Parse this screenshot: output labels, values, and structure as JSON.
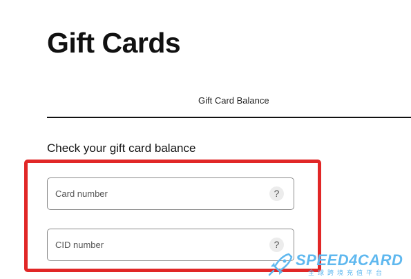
{
  "page": {
    "title": "Gift Cards"
  },
  "tabs": [
    {
      "label": "Gift Card Balance",
      "active": true
    }
  ],
  "balance_form": {
    "heading": "Check your gift card balance",
    "card_number": {
      "placeholder": "Card number",
      "value": "",
      "help_icon": "question-mark-icon",
      "help_glyph": "?"
    },
    "cid_number": {
      "placeholder": "CID number",
      "value": "",
      "help_icon": "question-mark-icon",
      "help_glyph": "?"
    }
  },
  "annotation": {
    "color": "#e12727"
  },
  "watermark": {
    "brand": "SPEED4CARD",
    "subtitle": "全球跨境充值平台",
    "color": "#5fb8ef",
    "icon": "rocket-icon"
  }
}
